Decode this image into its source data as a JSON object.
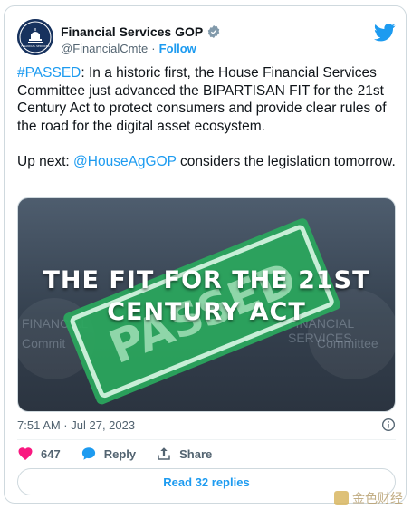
{
  "author": {
    "display_name": "Financial Services GOP",
    "handle": "@FinancialCmte",
    "separator": "·",
    "follow_label": "Follow",
    "avatar_text": "FINANCIAL SERVICES"
  },
  "tweet": {
    "hashtag": "#PASSED",
    "body_part1": ": In a historic first, the House Financial Services Committee just advanced the BIPARTISAN FIT for the 21st Century Act to protect consumers and provide clear rules of the road for the digital asset ecosystem.\n\nUp next: ",
    "mention": "@HouseAgGOP",
    "body_part2": " considers the legislation tomorrow."
  },
  "media": {
    "caption_line1": "THE FIT FOR THE 21ST",
    "caption_line2": "CENTURY ACT",
    "stamp_text": "PASSED",
    "bg_left_1": "FINANCIAL",
    "bg_left_2": "Commit",
    "bg_right_1": "FINANCIAL SERVICES",
    "bg_right_2": "Committee"
  },
  "meta": {
    "timestamp": "7:51 AM · Jul 27, 2023"
  },
  "actions": {
    "like_count": "647",
    "reply_label": "Reply",
    "share_label": "Share"
  },
  "read_replies_label": "Read 32 replies",
  "watermark": "金色财经",
  "colors": {
    "accent": "#1d9bf0",
    "like": "#f91880",
    "stamp_green": "#2aa85d"
  }
}
